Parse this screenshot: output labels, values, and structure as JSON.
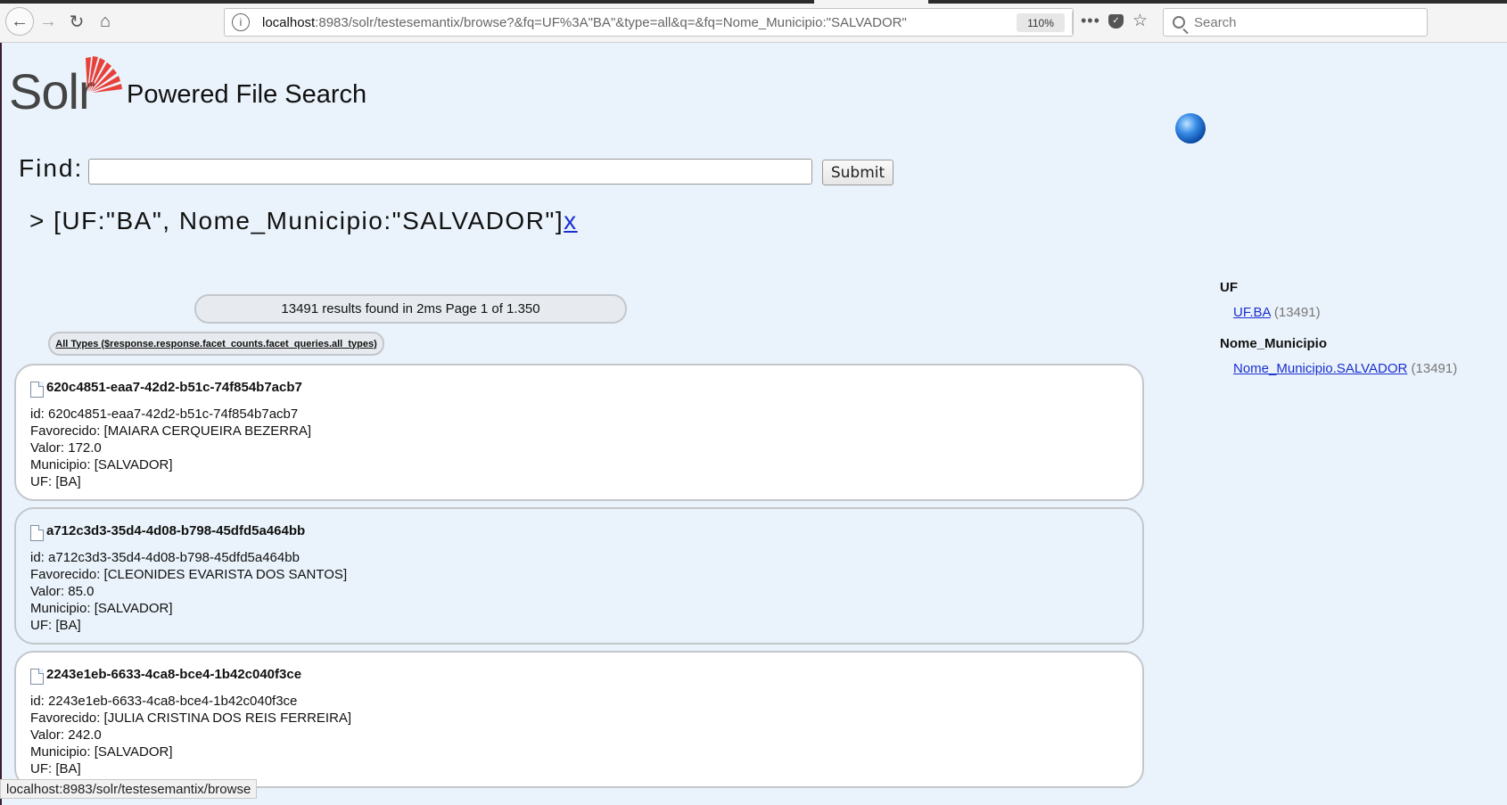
{
  "browser": {
    "url_host": "localhost",
    "url_rest": ":8983/solr/testesemantix/browse?&fq=UF%3A\"BA\"&type=all&q=&fq=Nome_Municipio:\"SALVADOR\"",
    "zoom": "110%",
    "search_placeholder": "Search",
    "status_url": "localhost:8983/solr/testesemantix/browse"
  },
  "header": {
    "logo_text": "Solr",
    "title": "Powered File Search"
  },
  "search": {
    "find_label": "Find:",
    "query_value": "",
    "submit_label": "Submit"
  },
  "filters": {
    "prefix": "> ",
    "text": "[UF:\"BA\", Nome_Municipio:\"SALVADOR\"]",
    "remove_label": "x"
  },
  "results": {
    "summary": "13491 results found in 2ms Page 1 of 1.350",
    "types_tab": "All Types ($response.response.facet_counts.facet_queries.all_types)"
  },
  "documents": [
    {
      "title": "620c4851-eaa7-42d2-b51c-74f854b7acb7",
      "id": "id: 620c4851-eaa7-42d2-b51c-74f854b7acb7",
      "favorecido": "Favorecido: [MAIARA CERQUEIRA BEZERRA]",
      "valor": "Valor: 172.0",
      "municipio": "Municipio: [SALVADOR]",
      "uf": "UF: [BA]"
    },
    {
      "title": "a712c3d3-35d4-4d08-b798-45dfd5a464bb",
      "id": "id: a712c3d3-35d4-4d08-b798-45dfd5a464bb",
      "favorecido": "Favorecido: [CLEONIDES EVARISTA DOS SANTOS]",
      "valor": "Valor: 85.0",
      "municipio": "Municipio: [SALVADOR]",
      "uf": "UF: [BA]"
    },
    {
      "title": "2243e1eb-6633-4ca8-bce4-1b42c040f3ce",
      "id": "id: 2243e1eb-6633-4ca8-bce4-1b42c040f3ce",
      "favorecido": "Favorecido: [JULIA CRISTINA DOS REIS FERREIRA]",
      "valor": "Valor: 242.0",
      "municipio": "Municipio: [SALVADOR]",
      "uf": "UF: [BA]"
    }
  ],
  "facets": [
    {
      "heading": "UF",
      "item": "UF.BA",
      "count": "(13491)"
    },
    {
      "heading": "Nome_Municipio",
      "item": "Nome_Municipio.SALVADOR",
      "count": "(13491)"
    }
  ],
  "colors": {
    "page_bg": "#eaf3fb",
    "link": "#1a2fd0",
    "logo_sun": "#e8413a"
  }
}
